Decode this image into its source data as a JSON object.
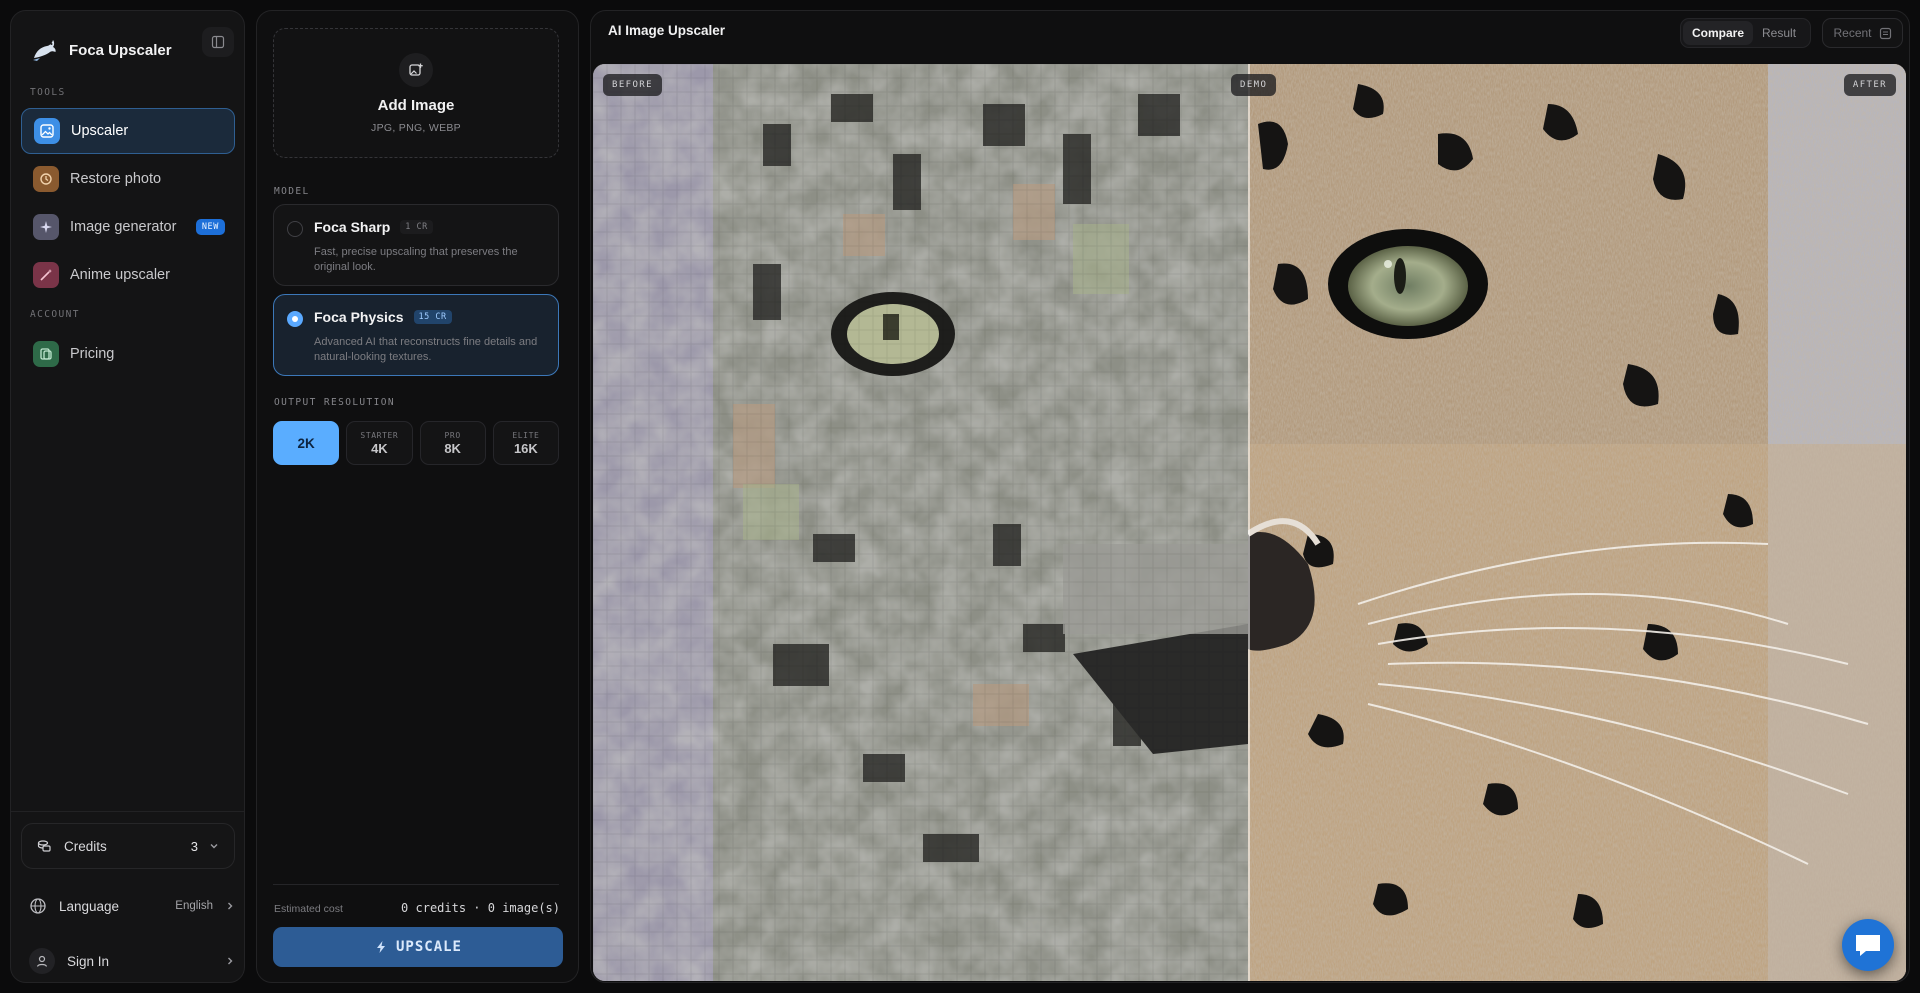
{
  "app": {
    "name": "Foca Upscaler"
  },
  "sidebar": {
    "tools_label": "TOOLS",
    "account_label": "ACCOUNT",
    "items": [
      {
        "label": "Upscaler",
        "icon": "image-icon",
        "active": true
      },
      {
        "label": "Restore photo",
        "icon": "restore-icon"
      },
      {
        "label": "Image generator",
        "icon": "sparkle-icon",
        "badge": "NEW"
      },
      {
        "label": "Anime upscaler",
        "icon": "wand-icon"
      }
    ],
    "account_items": [
      {
        "label": "Pricing",
        "icon": "tag-icon"
      }
    ],
    "credits": {
      "label": "Credits",
      "count": "3"
    },
    "language": {
      "label": "Language",
      "value": "English"
    },
    "signin": {
      "label": "Sign In"
    }
  },
  "panel": {
    "upload": {
      "title": "Add Image",
      "formats": "JPG, PNG, WEBP"
    },
    "model_label": "MODEL",
    "models": [
      {
        "name": "Foca Sharp",
        "cost": "1 CR",
        "desc": "Fast, precise upscaling that preserves the original look.",
        "selected": false
      },
      {
        "name": "Foca Physics",
        "cost": "15 CR",
        "desc": "Advanced AI that reconstructs fine details and natural-looking textures.",
        "selected": true
      }
    ],
    "resolution_label": "OUTPUT RESOLUTION",
    "resolutions": [
      {
        "tier": "",
        "value": "2K",
        "active": true
      },
      {
        "tier": "STARTER",
        "value": "4K"
      },
      {
        "tier": "PRO",
        "value": "8K"
      },
      {
        "tier": "ELITE",
        "value": "16K"
      }
    ],
    "estimated_cost_label": "Estimated cost",
    "estimated_cost_value": "0 credits · 0 image(s)",
    "upscale_label": "UPSCALE"
  },
  "main": {
    "title": "AI Image Upscaler",
    "tabs": [
      {
        "label": "Compare",
        "active": true
      },
      {
        "label": "Result"
      }
    ],
    "recent_label": "Recent",
    "viewer": {
      "before_label": "BEFORE",
      "demo_label": "DEMO",
      "after_label": "AFTER"
    }
  },
  "colors": {
    "accent": "#5aadff",
    "primary_button": "#2d5c95",
    "active_nav": "#1b2a3b",
    "badge": "#1d6fd8"
  }
}
